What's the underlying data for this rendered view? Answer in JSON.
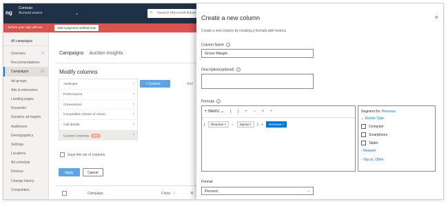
{
  "header": {
    "logo": "ng",
    "account_title": "Contoso",
    "account_sub": "Account source",
    "search_placeholder": "Search Microsoft Advert"
  },
  "alert": {
    "text": "ı before your ads will run.",
    "button": "Add a payment method now"
  },
  "sidebar": {
    "all_campaigns": "All campaigns",
    "items": [
      {
        "label": "Overview",
        "icon": "home-icon"
      },
      {
        "label": "Recommendations"
      },
      {
        "label": "Campaigns",
        "icon": "lock-icon",
        "active": true
      },
      {
        "label": "Ad groups"
      },
      {
        "label": "Ads & extensions"
      },
      {
        "label": "Landing pages"
      },
      {
        "label": "Keywords"
      },
      {
        "label": "Dynamic ad targets"
      },
      {
        "label": "Audiences"
      },
      {
        "label": "Demographics"
      },
      {
        "label": "Settings"
      },
      {
        "label": "Locations"
      },
      {
        "label": "Ad schedule"
      },
      {
        "label": "Devices"
      },
      {
        "label": "Change history"
      },
      {
        "label": "Competition"
      }
    ]
  },
  "main": {
    "tabs": [
      "Campaigns",
      "Auction insights"
    ],
    "modify_title": "Modify columns",
    "column_groups": [
      "Attributes",
      "Performance",
      "Conversions",
      "Competitive (Share of Voice)",
      "Call details",
      "Custom Columns"
    ],
    "new_badge": "New",
    "add_column_button": "+ Column",
    "add_link": "Add",
    "save_set_label": "Save this set of columns",
    "apply_button": "Apply",
    "cancel_button": "Cancel",
    "table_headers": {
      "campaign": "Campaign",
      "clicks": "Clicks",
      "sort": "ⓘ",
      "budget": "B"
    }
  },
  "dialog": {
    "title": "Create a new column",
    "close": "×",
    "description": "Create a new column by creating a formula with metrics.",
    "column_name_label": "Column Name",
    "column_name_value": "Gross Margin",
    "description_label": "Description(optional)",
    "formula_label": "Formula",
    "toolbar": {
      "metric": "+ Metric ⌄",
      "open_paren": "(",
      "close_paren": ")",
      "plus": "+",
      "minus": "−",
      "multiply": "×",
      "divide": "÷"
    },
    "expression": {
      "p1": "(",
      "chip1": "Revenue ×",
      "op1": "−",
      "chip2": "Spend ×",
      "p2": ")",
      "op2": "÷",
      "chip3": "Revenue ×"
    },
    "segment_title_prefix": "Segment for: ",
    "segment_title_value": "Revenue",
    "device_type": "⌄ Device Type",
    "device_options": [
      "Computer",
      "Smartphone",
      "Tablet"
    ],
    "network": "› Network",
    "top_vs_other": "› Top vs. Other",
    "format_label": "Format",
    "format_value": "Percent"
  }
}
